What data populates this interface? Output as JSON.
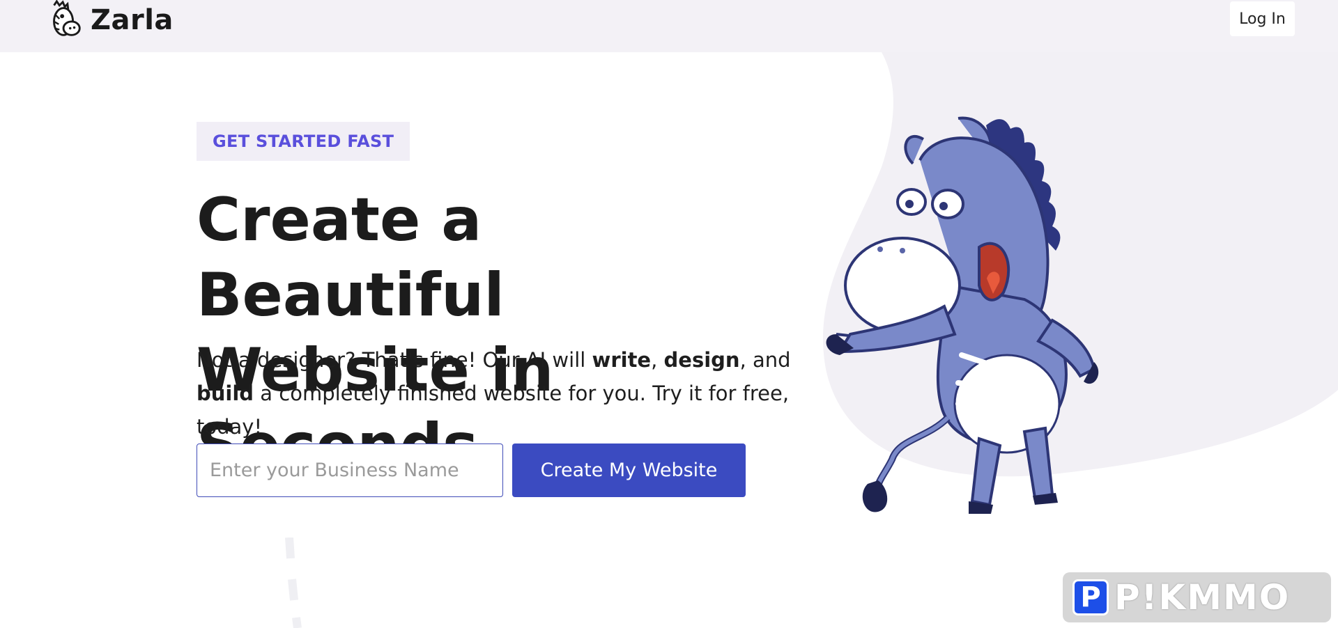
{
  "brand": {
    "name": "Zarla",
    "logo_icon": "zebra-logo-icon"
  },
  "header": {
    "login_label": "Log In"
  },
  "hero": {
    "badge": "GET STARTED FAST",
    "headline_line1": "Create a Beautiful",
    "headline_line2": "Website in Seconds",
    "sub_1": "Not a designer? That's fine! Our AI will ",
    "sub_write": "write",
    "sub_2": ", ",
    "sub_design": "design",
    "sub_3": ", and ",
    "sub_build": "build",
    "sub_4": " a completely finished website for you. Try it for free, today!",
    "input_placeholder": "Enter your Business Name",
    "cta_label": "Create My Website",
    "mascot_icon": "zebra-mascot-illustration"
  },
  "watermark": {
    "text": "P!KMMO",
    "p_letter": "P"
  },
  "colors": {
    "accent": "#3b4bc1",
    "badge_text": "#5a4fdc",
    "header_bg": "#f3f1f6"
  }
}
